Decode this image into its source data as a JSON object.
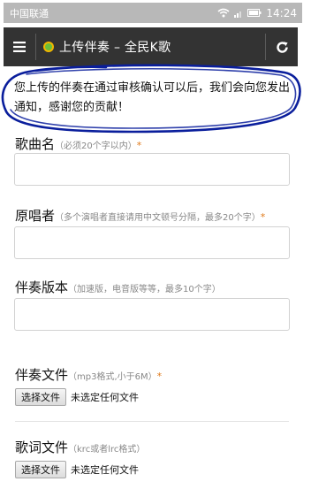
{
  "status_bar": {
    "carrier": "中国联通",
    "time": "14:24",
    "icons": [
      "wifi-icon",
      "signal-icon",
      "battery-icon"
    ]
  },
  "app_bar": {
    "title": "上传伴奏 – 全民K歌",
    "icons": [
      "menu-icon",
      "app-coin-icon",
      "refresh-icon"
    ]
  },
  "notice": {
    "text": "您上传的伴奏在通过审核确认可以后，我们会向您发出通知，感谢您的贡献！",
    "annotation_color": "#0a1e9c"
  },
  "form": {
    "song_name": {
      "label": "歌曲名",
      "hint": "（必须20个字以内）",
      "required": "*",
      "value": ""
    },
    "original_singer": {
      "label": "原唱者",
      "hint": "（多个演唱者直接请用中文顿号分隔，最多20个字）",
      "required": "*",
      "value": ""
    },
    "version": {
      "label": "伴奏版本",
      "hint": "（加速版，电音版等等，最多10个字）",
      "value": ""
    },
    "accompaniment_file": {
      "label": "伴奏文件",
      "hint": "（mp3格式,小于6M）",
      "required": "*",
      "button": "选择文件",
      "status": "未选定任何文件"
    },
    "lyrics_file": {
      "label": "歌词文件",
      "hint": "（krc或者lrc格式）",
      "button": "选择文件",
      "status": "未选定任何文件"
    }
  },
  "colors": {
    "app_bar": "#333333",
    "required": "#e07a1a",
    "status_bar": "#b8b8b8"
  }
}
